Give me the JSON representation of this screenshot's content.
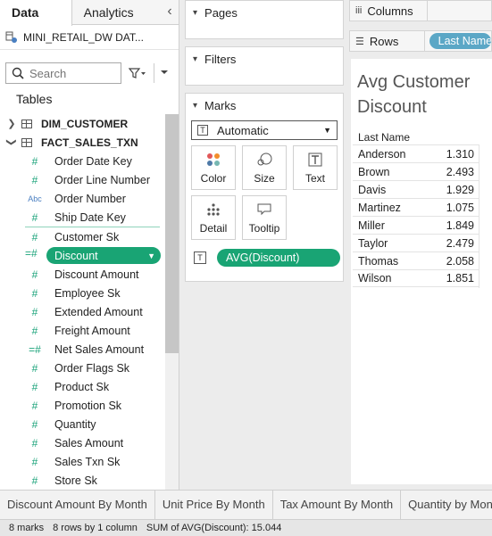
{
  "left_pane": {
    "tabs": {
      "data": "Data",
      "analytics": "Analytics",
      "collapse_glyph": "‹"
    },
    "datasource_name": "MINI_RETAIL_DW DAT...",
    "search": {
      "placeholder": "Search"
    },
    "tables_label": "Tables",
    "tables": [
      {
        "name": "DIM_CUSTOMER",
        "expanded": false
      },
      {
        "name": "FACT_SALES_TXN",
        "expanded": true
      }
    ],
    "fields": [
      {
        "name": "Order Date Key",
        "type": "number"
      },
      {
        "name": "Order Line Number",
        "type": "number"
      },
      {
        "name": "Order Number",
        "type": "string",
        "type_glyph": "Abc"
      },
      {
        "name": "Ship Date Key",
        "type": "number"
      },
      {
        "name": "Customer Sk",
        "type": "number"
      },
      {
        "name": "Discount",
        "type": "number",
        "selected": true
      },
      {
        "name": "Discount Amount",
        "type": "number"
      },
      {
        "name": "Employee Sk",
        "type": "number"
      },
      {
        "name": "Extended Amount",
        "type": "number"
      },
      {
        "name": "Freight Amount",
        "type": "number"
      },
      {
        "name": "Net Sales Amount",
        "type": "number",
        "calculated": true
      },
      {
        "name": "Order Flags Sk",
        "type": "number"
      },
      {
        "name": "Product Sk",
        "type": "number"
      },
      {
        "name": "Promotion Sk",
        "type": "number"
      },
      {
        "name": "Quantity",
        "type": "number"
      },
      {
        "name": "Sales Amount",
        "type": "number"
      },
      {
        "name": "Sales Txn Sk",
        "type": "number"
      },
      {
        "name": "Store Sk",
        "type": "number"
      }
    ],
    "colors": {
      "selected_field": "#19a474",
      "number_icon": "#1aa37a"
    }
  },
  "mid_pane": {
    "pages_label": "Pages",
    "filters_label": "Filters",
    "marks_label": "Marks",
    "mark_type": "Automatic",
    "mark_buttons": [
      {
        "label": "Color",
        "icon": "color-dots-icon"
      },
      {
        "label": "Size",
        "icon": "size-circles-icon"
      },
      {
        "label": "Text",
        "icon": "text-T-icon"
      },
      {
        "label": "Detail",
        "icon": "detail-dots-icon"
      },
      {
        "label": "Tooltip",
        "icon": "tooltip-bubble-icon"
      }
    ],
    "text_pill": "AVG(Discount)"
  },
  "right_pane": {
    "columns_label": "Columns",
    "rows_label": "Rows",
    "rows_pill": "Last Name",
    "rows_pill_color": "#5ba7c6",
    "view": {
      "title": "Avg Customer Discount",
      "column_header": "Last Name",
      "rows": [
        {
          "last_name": "Anderson",
          "avg_discount": "1.310"
        },
        {
          "last_name": "Brown",
          "avg_discount": "2.493"
        },
        {
          "last_name": "Davis",
          "avg_discount": "1.929"
        },
        {
          "last_name": "Martinez",
          "avg_discount": "1.075"
        },
        {
          "last_name": "Miller",
          "avg_discount": "1.849"
        },
        {
          "last_name": "Taylor",
          "avg_discount": "2.479"
        },
        {
          "last_name": "Thomas",
          "avg_discount": "2.058"
        },
        {
          "last_name": "Wilson",
          "avg_discount": "1.851"
        }
      ]
    }
  },
  "sheet_tabs": [
    "Discount Amount By Month",
    "Unit Price By Month",
    "Tax Amount By Month",
    "Quantity by Month"
  ],
  "status_bar": {
    "marks": "8 marks",
    "dimensions": "8 rows by 1 column",
    "sum": "SUM of AVG(Discount): 15.044"
  }
}
